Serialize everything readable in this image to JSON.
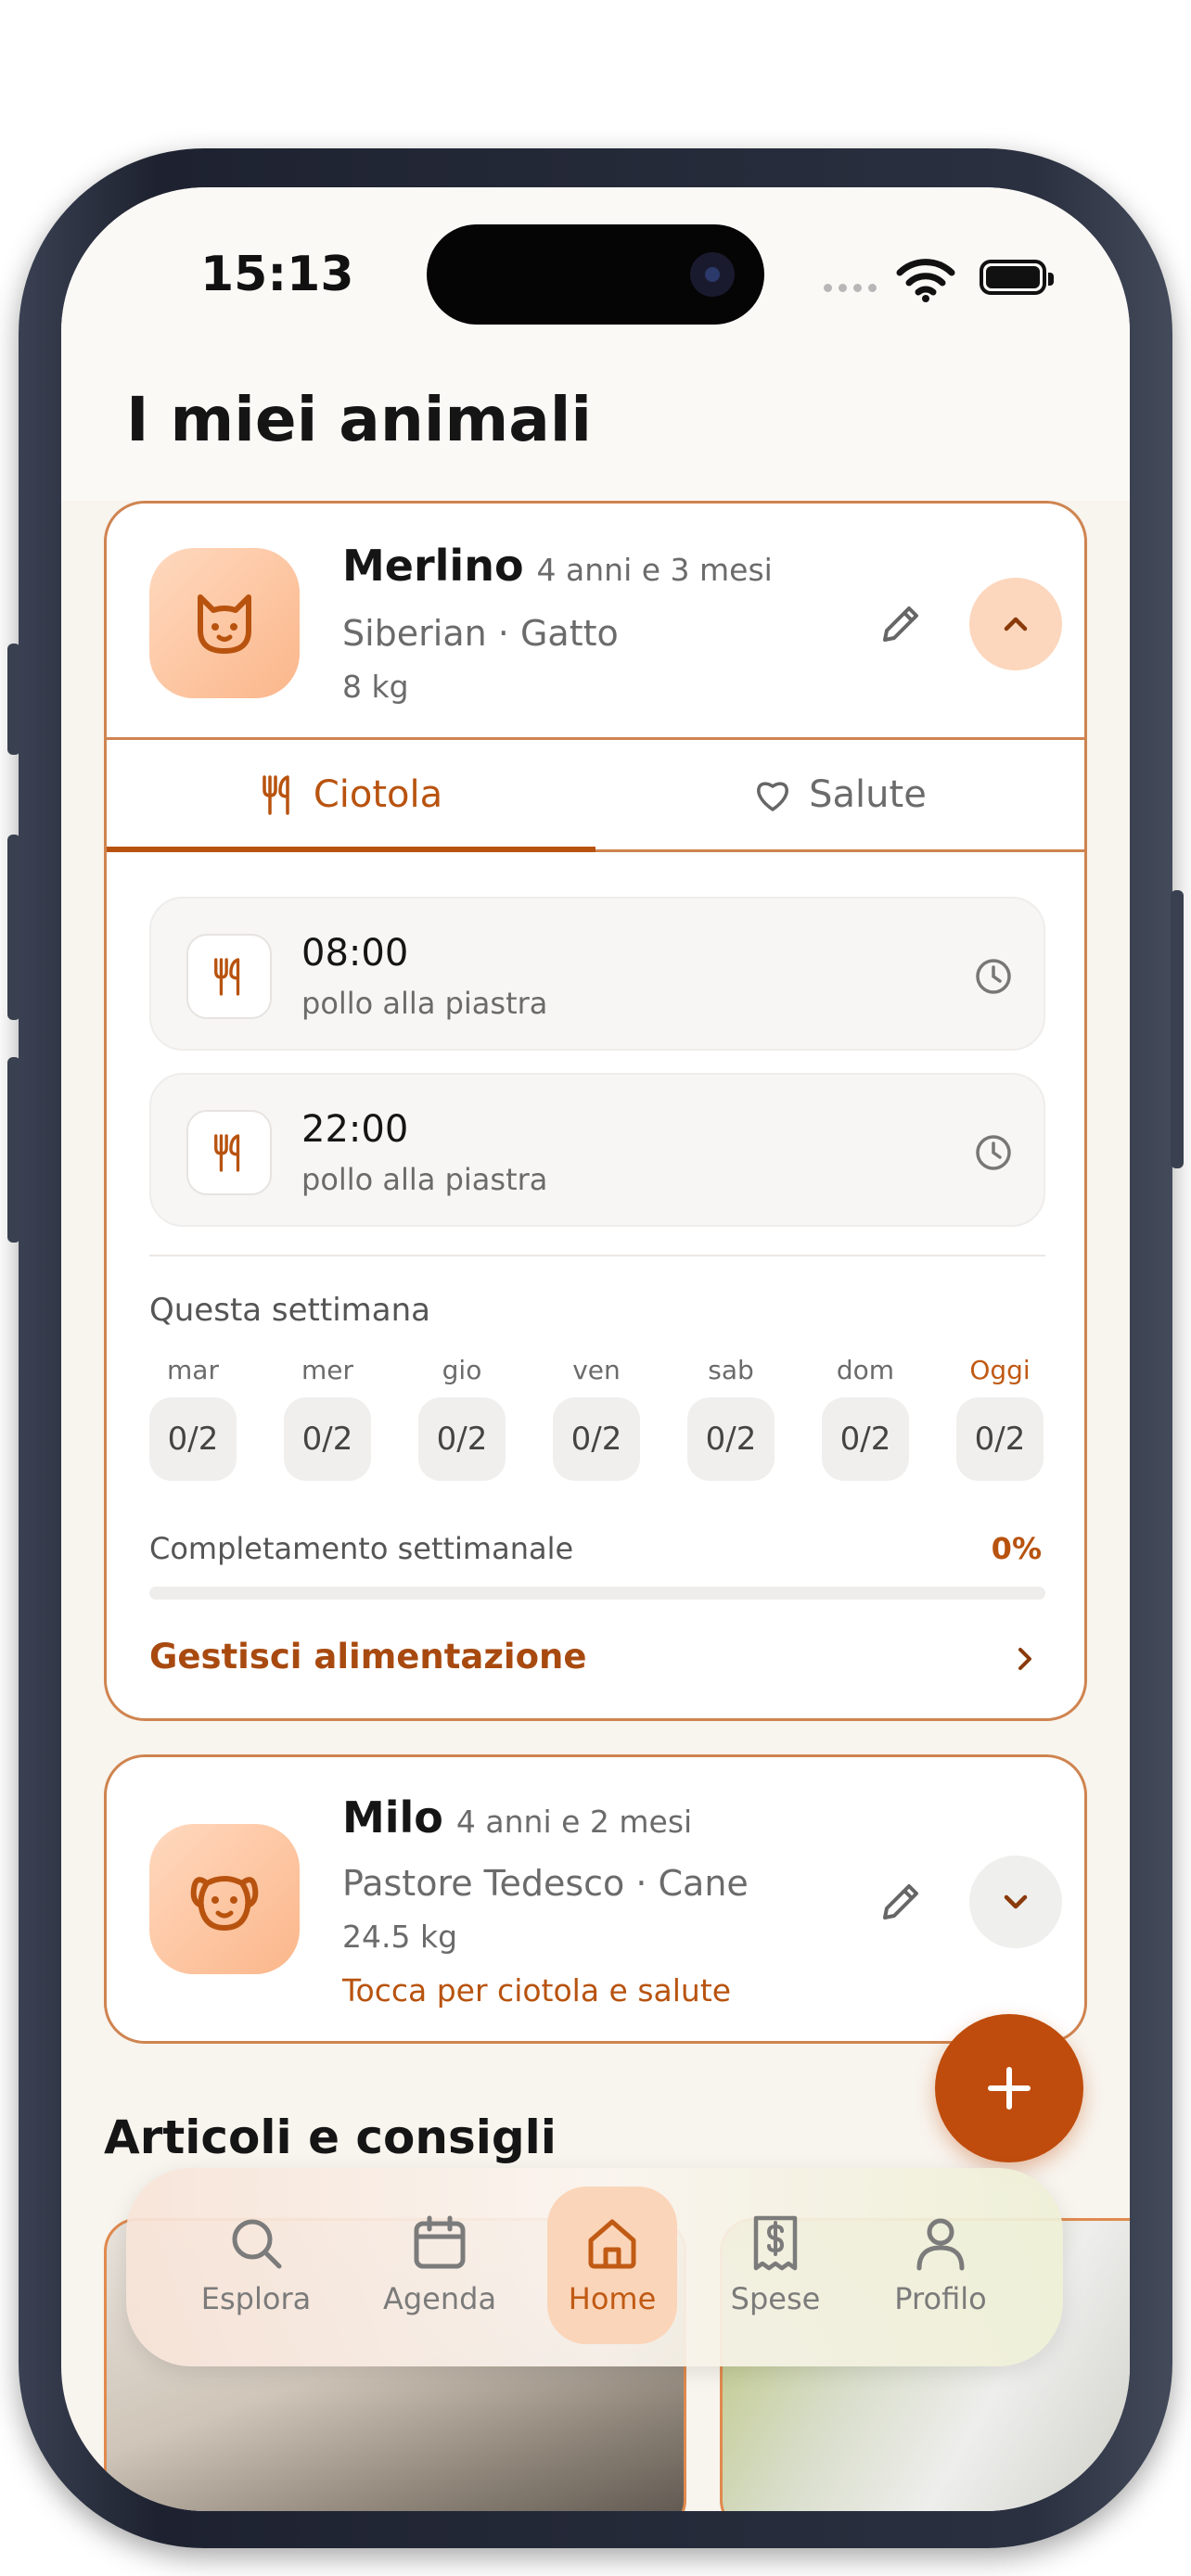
{
  "status_bar": {
    "time": "15:13"
  },
  "page_title": "I miei animali",
  "pets": [
    {
      "name": "Merlino",
      "age": "4 anni e 3 mesi",
      "breed_species": "Siberian · Gatto",
      "weight": "8 kg",
      "icon": "cat-icon",
      "expanded": true,
      "tabs": [
        {
          "label": "Ciotola",
          "icon": "fork-knife-icon",
          "active": true
        },
        {
          "label": "Salute",
          "icon": "heart-icon",
          "active": false
        }
      ],
      "meals": [
        {
          "time": "08:00",
          "food": "pollo alla piastra"
        },
        {
          "time": "22:00",
          "food": "pollo alla piastra"
        }
      ],
      "week": {
        "title": "Questa settimana",
        "days": [
          {
            "label": "mar",
            "value": "0/2"
          },
          {
            "label": "mer",
            "value": "0/2"
          },
          {
            "label": "gio",
            "value": "0/2"
          },
          {
            "label": "ven",
            "value": "0/2"
          },
          {
            "label": "sab",
            "value": "0/2"
          },
          {
            "label": "dom",
            "value": "0/2"
          },
          {
            "label": "Oggi",
            "value": "0/2",
            "today": true
          }
        ],
        "completion_label": "Completamento settimanale",
        "completion_value": "0%",
        "completion_fraction": 0
      },
      "manage_link": "Gestisci alimentazione"
    },
    {
      "name": "Milo",
      "age": "4 anni e 2 mesi",
      "breed_species": "Pastore Tedesco · Cane",
      "weight": "24.5 kg",
      "icon": "dog-icon",
      "expanded": false,
      "hint": "Tocca per ciotola e salute"
    }
  ],
  "articles": {
    "title": "Articoli e consigli"
  },
  "fab": {
    "icon": "plus-icon"
  },
  "nav": [
    {
      "label": "Esplora",
      "icon": "search-icon",
      "active": false
    },
    {
      "label": "Agenda",
      "icon": "calendar-icon",
      "active": false
    },
    {
      "label": "Home",
      "icon": "home-icon",
      "active": true
    },
    {
      "label": "Spese",
      "icon": "receipt-icon",
      "active": false
    },
    {
      "label": "Profilo",
      "icon": "user-icon",
      "active": false
    }
  ],
  "colors": {
    "accent": "#b8530f",
    "card_border": "#cf8450",
    "avatar": "#fbb68a",
    "fab": "#bf4c0c"
  }
}
